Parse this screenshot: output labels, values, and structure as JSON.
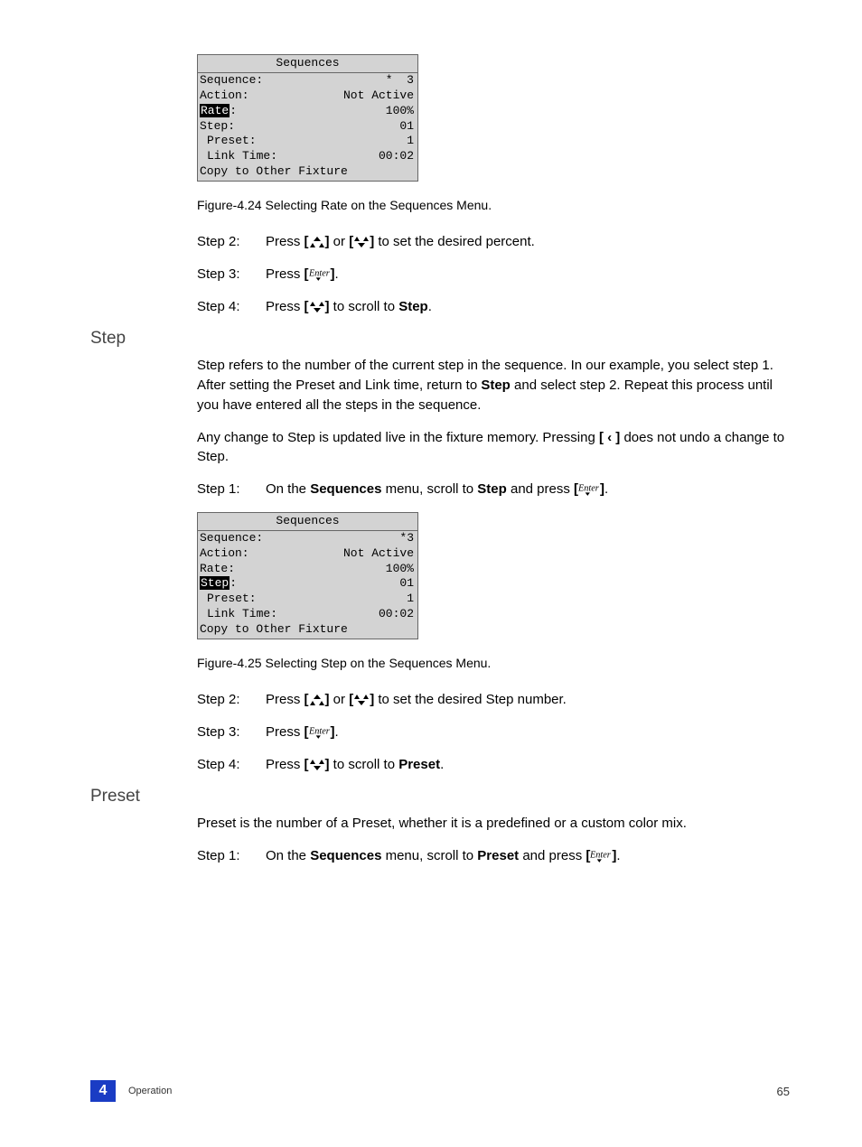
{
  "menuA": {
    "title": "Sequences",
    "rows": [
      {
        "label": "Sequence:",
        "value": "*  3",
        "indent": false
      },
      {
        "label": "Action:",
        "value": "Not Active",
        "indent": false
      },
      {
        "label": "Rate:",
        "value": "100%",
        "indent": false,
        "highlightLabel": true,
        "hlText": "Rate"
      },
      {
        "label": "Step:",
        "value": "01",
        "indent": false
      },
      {
        "label": "Preset:",
        "value": "1",
        "indent": true
      },
      {
        "label": "Link Time:",
        "value": "00:02",
        "indent": true
      },
      {
        "label": "Copy to Other Fixture",
        "value": "",
        "indent": false
      }
    ]
  },
  "figA": "Figure-4.24 Selecting Rate on the Sequences Menu.",
  "stepsA": [
    {
      "label": "Step 2:",
      "pre": "Press ",
      "b1": "[",
      "icon1": "up",
      "b1b": "]",
      "mid": " or ",
      "b2": "[",
      "icon2": "down",
      "b2b": "]",
      "post": " to set the desired percent."
    },
    {
      "label": "Step 3:",
      "pre": "Press ",
      "b1": "[",
      "icon1": "enter",
      "b1b": "]",
      "mid": "",
      "post": "."
    },
    {
      "label": "Step 4:",
      "pre": "Press ",
      "b1": "[",
      "icon1": "down",
      "b1b": "]",
      "mid": "",
      "post1": " to scroll to ",
      "bold1": "Step",
      "post2": "."
    }
  ],
  "sectStep": {
    "heading": "Step",
    "p1a": "Step refers to the number of the current step in the sequence. In our example, you select step 1. After setting the Preset and Link time, return to ",
    "p1bold": "Step",
    "p1b": " and select step 2. Repeat this process until you have entered all the steps in the sequence.",
    "p2a": "Any change to Step is updated live in the fixture memory. Pressing ",
    "p2bold": "[ ‹ ]",
    "p2b": " does not undo a change to Step.",
    "step1": {
      "label": "Step 1:",
      "pre": "On the ",
      "bold1": "Sequences",
      "mid": " menu, scroll to ",
      "bold2": "Step",
      "post": " and press ",
      "b1": "[",
      "icon1": "enter",
      "b1b": "]",
      "tail": "."
    }
  },
  "menuB": {
    "title": "Sequences",
    "rows": [
      {
        "label": "Sequence:",
        "value": "*3",
        "indent": false
      },
      {
        "label": "Action:",
        "value": "Not Active",
        "indent": false
      },
      {
        "label": "Rate:",
        "value": "100%",
        "indent": false
      },
      {
        "label": "Step:",
        "value": "01",
        "indent": false,
        "highlightLabel": true,
        "hlText": "Step"
      },
      {
        "label": "Preset:",
        "value": "1",
        "indent": true
      },
      {
        "label": "Link Time:",
        "value": "00:02",
        "indent": true
      },
      {
        "label": "Copy to Other Fixture",
        "value": "",
        "indent": false
      }
    ]
  },
  "figB": "Figure-4.25 Selecting Step on the Sequences Menu.",
  "stepsB": [
    {
      "label": "Step 2:",
      "pre": "Press ",
      "b1": "[",
      "icon1": "up",
      "b1b": "]",
      "mid": " or ",
      "b2": "[",
      "icon2": "down",
      "b2b": "]",
      "post": " to set the desired Step number."
    },
    {
      "label": "Step 3:",
      "pre": "Press ",
      "b1": "[",
      "icon1": "enter",
      "b1b": "]",
      "mid": "",
      "post": "."
    },
    {
      "label": "Step 4:",
      "pre": "Press ",
      "b1": "[",
      "icon1": "down",
      "b1b": "]",
      "mid": "",
      "post1": " to scroll to ",
      "bold1": "Preset",
      "post2": "."
    }
  ],
  "sectPreset": {
    "heading": "Preset",
    "p1": "Preset is the number of a Preset, whether it is a predefined or a custom color mix.",
    "step1": {
      "label": "Step 1:",
      "pre": "On the ",
      "bold1": "Sequences",
      "mid": " menu, scroll to ",
      "bold2": "Preset",
      "post": " and press ",
      "b1": "[",
      "icon1": "enter",
      "b1b": "]",
      "tail": "."
    }
  },
  "footer": {
    "chapter": "4",
    "title": "Operation",
    "page": "65"
  }
}
